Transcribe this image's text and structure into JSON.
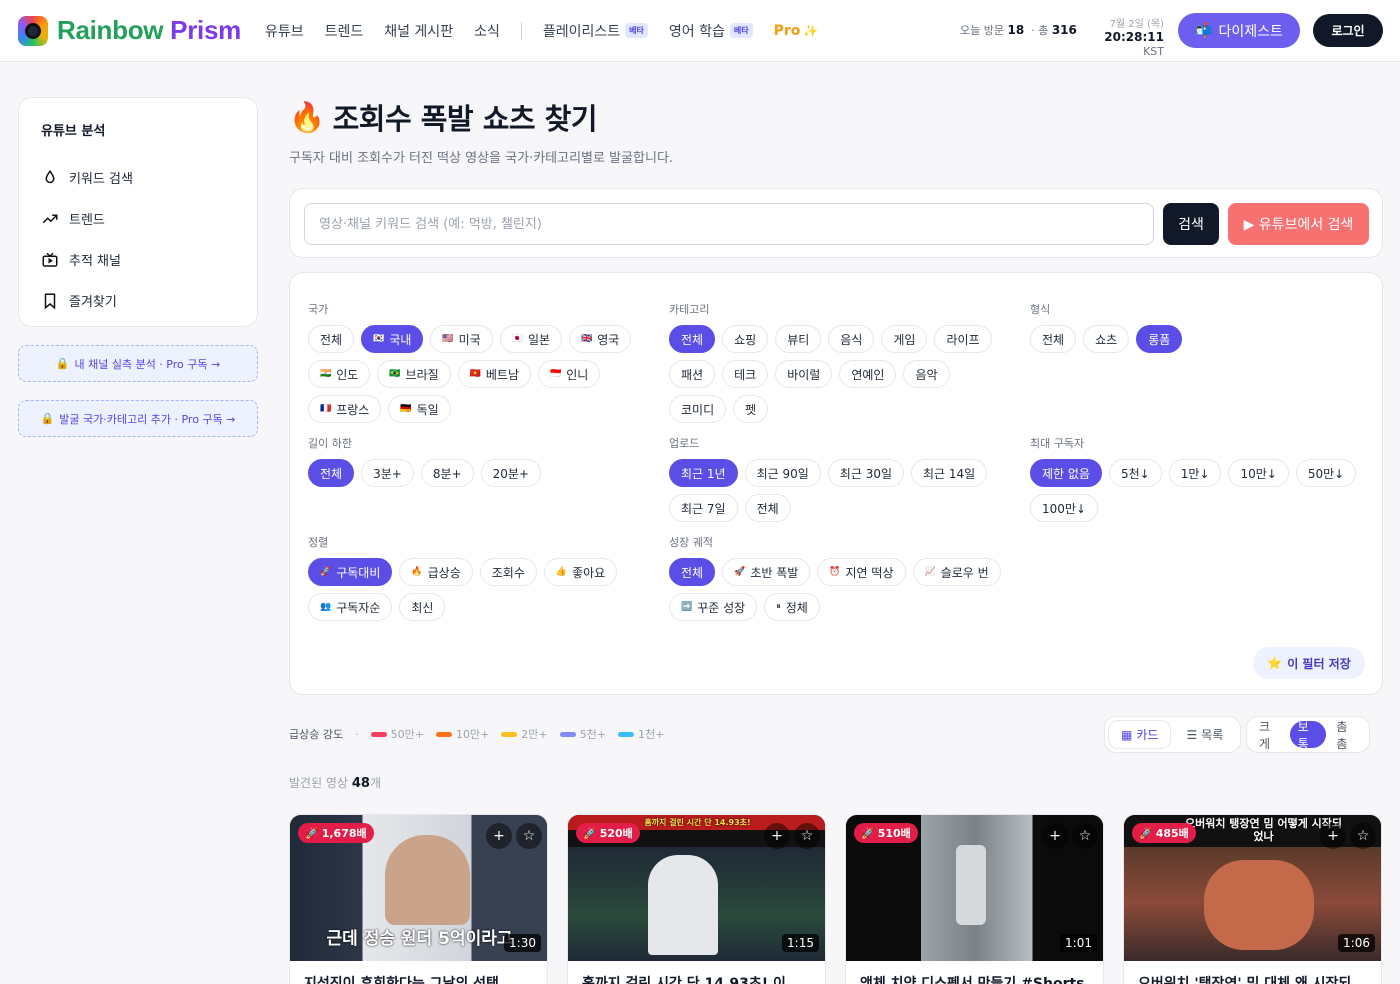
{
  "header": {
    "brand_part1": "Rainbow",
    "brand_part2": "Prism",
    "nav": [
      "유튜브",
      "트렌드",
      "채널 게시판",
      "소식"
    ],
    "nav2": [
      {
        "label": "플레이리스트",
        "badge": "베타"
      },
      {
        "label": "영어 학습",
        "badge": "베타"
      }
    ],
    "pro_label": "Pro",
    "today_label": "오늘 방문",
    "today_value": "18",
    "total_label": "총",
    "total_value": "316",
    "date": "7월 2일 (목)",
    "time": "20:28:11",
    "tz": "KST",
    "digest_label": "다이제스트",
    "login_label": "로그인"
  },
  "sidebar": {
    "title": "유튜브 분석",
    "items": [
      {
        "label": "키워드 검색",
        "icon": "drop-icon"
      },
      {
        "label": "트렌드",
        "icon": "trending-icon"
      },
      {
        "label": "추적 채널",
        "icon": "tv-icon"
      },
      {
        "label": "즐겨찾기",
        "icon": "bookmark-icon"
      }
    ],
    "promo1": "내 채널 실측 분석 · Pro 구독 →",
    "promo2": "발굴 국가·카테고리 추가 · Pro 구독 →"
  },
  "page": {
    "title": "조회수 폭발 쇼츠 찾기",
    "subtitle": "구독자 대비 조회수가 터진 떡상 영상을 국가·카테고리별로 발굴합니다.",
    "search_placeholder": "영상·채널 키워드 검색 (예: 먹방, 챌린지)",
    "search_button": "검색",
    "yt_button": "▶ 유튜브에서 검색"
  },
  "filters": {
    "country": {
      "label": "국가",
      "options": [
        {
          "flag": "",
          "text": "전체",
          "on": false
        },
        {
          "flag": "🇰🇷",
          "text": "국내",
          "on": true
        },
        {
          "flag": "🇺🇸",
          "text": "미국",
          "on": false
        },
        {
          "flag": "🇯🇵",
          "text": "일본",
          "on": false
        },
        {
          "flag": "🇬🇧",
          "text": "영국",
          "on": false
        },
        {
          "flag": "🇮🇳",
          "text": "인도",
          "on": false
        },
        {
          "flag": "🇧🇷",
          "text": "브라질",
          "on": false
        },
        {
          "flag": "🇻🇳",
          "text": "베트남",
          "on": false
        },
        {
          "flag": "🇮🇩",
          "text": "인니",
          "on": false
        },
        {
          "flag": "🇫🇷",
          "text": "프랑스",
          "on": false
        },
        {
          "flag": "🇩🇪",
          "text": "독일",
          "on": false
        }
      ]
    },
    "category": {
      "label": "카테고리",
      "options": [
        {
          "text": "전체",
          "on": true
        },
        {
          "text": "쇼핑",
          "on": false
        },
        {
          "text": "뷰티",
          "on": false
        },
        {
          "text": "음식",
          "on": false
        },
        {
          "text": "게임",
          "on": false
        },
        {
          "text": "라이프",
          "on": false
        },
        {
          "text": "패션",
          "on": false
        },
        {
          "text": "테크",
          "on": false
        },
        {
          "text": "바이럴",
          "on": false
        },
        {
          "text": "연예인",
          "on": false
        },
        {
          "text": "음악",
          "on": false
        },
        {
          "text": "코미디",
          "on": false
        },
        {
          "text": "펫",
          "on": false
        }
      ]
    },
    "format": {
      "label": "형식",
      "options": [
        {
          "text": "전체",
          "on": false
        },
        {
          "text": "쇼츠",
          "on": false
        },
        {
          "text": "롱폼",
          "on": true
        }
      ]
    },
    "length": {
      "label": "길이 하한",
      "options": [
        {
          "text": "전체",
          "on": true
        },
        {
          "text": "3분+",
          "on": false
        },
        {
          "text": "8분+",
          "on": false
        },
        {
          "text": "20분+",
          "on": false
        }
      ]
    },
    "upload": {
      "label": "업로드",
      "options": [
        {
          "text": "최근 1년",
          "on": true
        },
        {
          "text": "최근 90일",
          "on": false
        },
        {
          "text": "최근 30일",
          "on": false
        },
        {
          "text": "최근 14일",
          "on": false
        },
        {
          "text": "최근 7일",
          "on": false
        },
        {
          "text": "전체",
          "on": false
        }
      ]
    },
    "subs": {
      "label": "최대 구독자",
      "options": [
        {
          "text": "제한 없음",
          "on": true
        },
        {
          "text": "5천↓",
          "on": false
        },
        {
          "text": "1만↓",
          "on": false
        },
        {
          "text": "10만↓",
          "on": false
        },
        {
          "text": "50만↓",
          "on": false
        },
        {
          "text": "100만↓",
          "on": false
        }
      ]
    },
    "sort": {
      "label": "정렬",
      "options": [
        {
          "flag": "🚀",
          "text": "구독대비",
          "on": true
        },
        {
          "flag": "🔥",
          "text": "급상승",
          "on": false
        },
        {
          "flag": "",
          "text": "조회수",
          "on": false
        },
        {
          "flag": "👍",
          "text": "좋아요",
          "on": false
        },
        {
          "flag": "👥",
          "text": "구독자순",
          "on": false
        },
        {
          "flag": "",
          "text": "최신",
          "on": false
        }
      ]
    },
    "growth": {
      "label": "성장 궤적",
      "options": [
        {
          "flag": "",
          "text": "전체",
          "on": true
        },
        {
          "flag": "🚀",
          "text": "초반 폭발",
          "on": false
        },
        {
          "flag": "⏰",
          "text": "지연 떡상",
          "on": false
        },
        {
          "flag": "📈",
          "text": "슬로우 번",
          "on": false
        },
        {
          "flag": "➡️",
          "text": "꾸준 성장",
          "on": false
        },
        {
          "flag": "⏸",
          "text": "정체",
          "on": false
        }
      ]
    },
    "save_label": "이 필터 저장"
  },
  "legend": {
    "title": "급상승 강도",
    "items": [
      {
        "label": "50만+",
        "color": "#f43f5e"
      },
      {
        "label": "10만+",
        "color": "#f97316"
      },
      {
        "label": "2만+",
        "color": "#fbbf24"
      },
      {
        "label": "5천+",
        "color": "#818cf8"
      },
      {
        "label": "1천+",
        "color": "#38bdf8"
      }
    ]
  },
  "view": {
    "card_label": "카드",
    "list_label": "목록",
    "sizes": [
      "크게",
      "보통",
      "촘촘"
    ],
    "size_on": "보통"
  },
  "found": {
    "label": "발견된 영상",
    "count": "48",
    "unit": "개"
  },
  "cards": [
    {
      "badge": "1,678배",
      "duration": "1:30",
      "title": "지석진이 후회한다는 그날의 선택",
      "overlay": "근데 정승 원더 5억이라고"
    },
    {
      "badge": "520배",
      "duration": "1:15",
      "title": "홈까지 걸린 시간 단 14.93초! 이",
      "overlay": "홈까지 걸린 시간 단 14.93초!"
    },
    {
      "badge": "510배",
      "duration": "1:01",
      "title": "액체 치약 디스펜서 만들기 #Shorts",
      "overlay": ""
    },
    {
      "badge": "485배",
      "duration": "1:06",
      "title": "오버워치 '탱장연' 밈 대체 왜 시작되",
      "overlay": "오버워치 탱장연 밈 어떻게 시작되었나"
    }
  ]
}
